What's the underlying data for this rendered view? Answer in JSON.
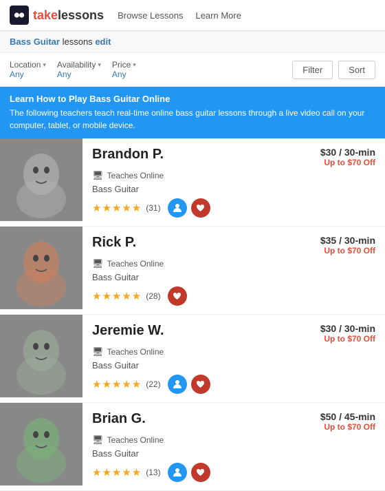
{
  "header": {
    "logo_text": "takelessons",
    "nav_items": [
      "Browse Lessons",
      "Learn More"
    ]
  },
  "breadcrumb": {
    "subject": "Bass Guitar",
    "suffix": " lessons",
    "edit_label": "edit"
  },
  "filters": {
    "location_label": "Location",
    "location_value": "Any",
    "availability_label": "Availability",
    "availability_value": "Any",
    "price_label": "Price",
    "price_value": "Any",
    "filter_btn": "Filter",
    "sort_btn": "Sort"
  },
  "banner": {
    "title": "Learn How to Play Bass Guitar Online",
    "description": "The following teachers teach real-time online bass guitar lessons through a live video call on your computer, tablet, or mobile device."
  },
  "teachers": [
    {
      "name": "Brandon P.",
      "teaches_online": "Teaches Online",
      "specialty": "Bass Guitar",
      "rating": 5,
      "review_count": 31,
      "price": "$30",
      "duration": "30-min",
      "discount": "Up to $70 Off",
      "has_profile_btn": true,
      "has_favorite_btn": true,
      "photo_class": "photo-1"
    },
    {
      "name": "Rick P.",
      "teaches_online": "Teaches Online",
      "specialty": "Bass Guitar",
      "rating": 5,
      "review_count": 28,
      "price": "$35",
      "duration": "30-min",
      "discount": "Up to $70 Off",
      "has_profile_btn": false,
      "has_favorite_btn": true,
      "photo_class": "photo-2"
    },
    {
      "name": "Jeremie W.",
      "teaches_online": "Teaches Online",
      "specialty": "Bass Guitar",
      "rating": 5,
      "review_count": 22,
      "price": "$30",
      "duration": "30-min",
      "discount": "Up to $70 Off",
      "has_profile_btn": true,
      "has_favorite_btn": true,
      "photo_class": "photo-3"
    },
    {
      "name": "Brian G.",
      "teaches_online": "Teaches Online",
      "specialty": "Bass Guitar",
      "rating": 5,
      "review_count": 13,
      "price": "$50",
      "duration": "45-min",
      "discount": "Up to $70 Off",
      "has_profile_btn": true,
      "has_favorite_btn": true,
      "photo_class": "photo-4"
    }
  ]
}
